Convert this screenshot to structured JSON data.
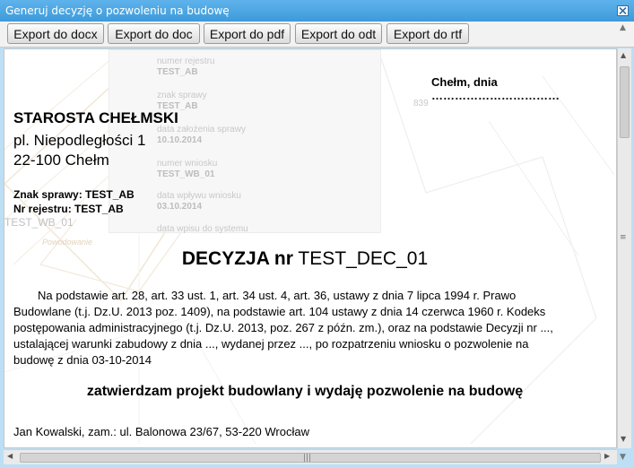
{
  "window": {
    "title": "Generuj decyzję o pozwoleniu na budowę"
  },
  "toolbar": {
    "buttons": [
      {
        "label": "Export do docx"
      },
      {
        "label": "Export do doc"
      },
      {
        "label": "Export do pdf"
      },
      {
        "label": "Export do odt"
      },
      {
        "label": "Export do rtf"
      }
    ]
  },
  "background_form": {
    "fields": [
      {
        "label": "numer rejestru",
        "value": "TEST_AB"
      },
      {
        "label": "znak sprawy",
        "value": "TEST_AB"
      },
      {
        "label": "data założenia sprawy",
        "value": "10.10.2014"
      },
      {
        "label": "numer wniosku",
        "value": "TEST_WB_01"
      },
      {
        "label": "data wpływu wniosku",
        "value": "03.10.2014"
      },
      {
        "label": "data wpisu do systemu",
        "value": ""
      }
    ],
    "side_number": "839",
    "map_label": "TEST_WB_01",
    "map_sublabel": "Powodowanie"
  },
  "document": {
    "place_date": "Chełm, dnia ……………………………",
    "authority": "STAROSTA CHEŁMSKI",
    "address_line1": "pl. Niepodległości 1",
    "address_line2": "22-100 Chełm",
    "case_sign": "Znak sprawy: TEST_AB",
    "register_no": "Nr rejestru: TEST_AB",
    "decision_prefix": "DECYZJA nr",
    "decision_number": "TEST_DEC_01",
    "body_lines": [
      "Na podstawie art. 28, art. 33 ust. 1, art. 34 ust. 4, art. 36,  ustawy z dnia 7 lipca 1994 r. Prawo",
      "Budowlane (t.j. Dz.U. 2013 poz. 1409), na podstawie art. 104 ustawy z dnia 14 czerwca 1960 r. Kodeks",
      "postępowania administracyjnego (t.j. Dz.U. 2013, poz. 267 z późn. zm.), oraz na podstawie Decyzji  nr ...,",
      "ustalającej warunki zabudowy z dnia ..., wydanej przez ..., po rozpatrzeniu wniosku o pozwolenie na",
      "budowę z dnia 03-10-2014"
    ],
    "approval": "zatwierdzam projekt budowlany i wydaję pozwolenie na budowę",
    "applicant": "Jan Kowalski, zam.: ul. Balonowa 23/67, 53-220 Wrocław"
  }
}
